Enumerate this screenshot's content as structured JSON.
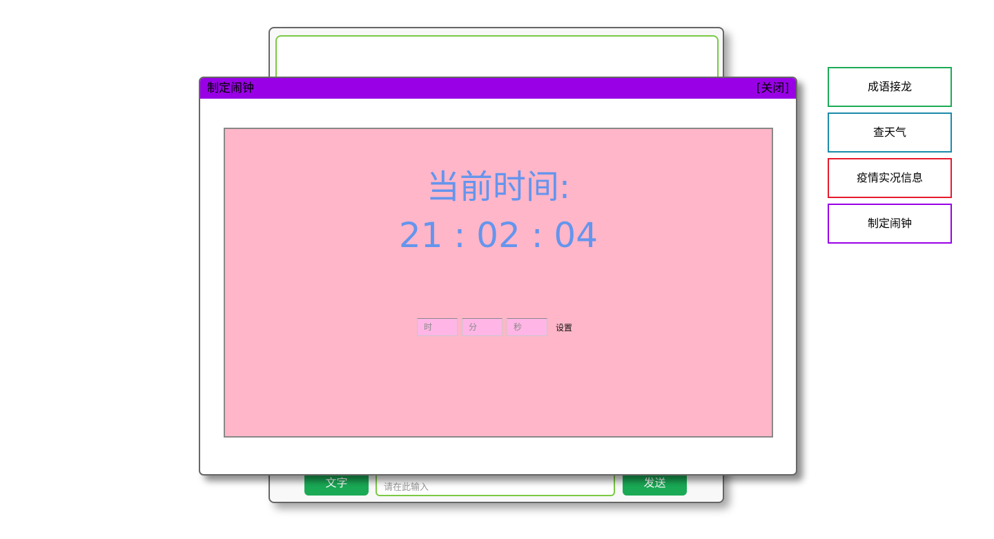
{
  "background_chat": {
    "type_button_label": "文字",
    "input_placeholder": "请在此输入",
    "send_button_label": "发送",
    "button_color": "#1aaa55",
    "border_color": "#7ac943"
  },
  "modal": {
    "title": "制定闹钟",
    "close_label": "[关闭]",
    "header_color": "#9900e6",
    "clock": {
      "label": "当前时间:",
      "time": "21 : 02 : 04",
      "text_color": "#6495ed",
      "panel_color": "#ffb6c8"
    },
    "alarm": {
      "hour_placeholder": "时",
      "minute_placeholder": "分",
      "second_placeholder": "秒",
      "set_label": "设置"
    }
  },
  "menu": [
    {
      "label": "成语接龙",
      "border_color": "#1aaa55"
    },
    {
      "label": "查天气",
      "border_color": "#1a8aaa"
    },
    {
      "label": "疫情实况信息",
      "border_color": "#e6192b"
    },
    {
      "label": "制定闹钟",
      "border_color": "#9900e6"
    }
  ]
}
